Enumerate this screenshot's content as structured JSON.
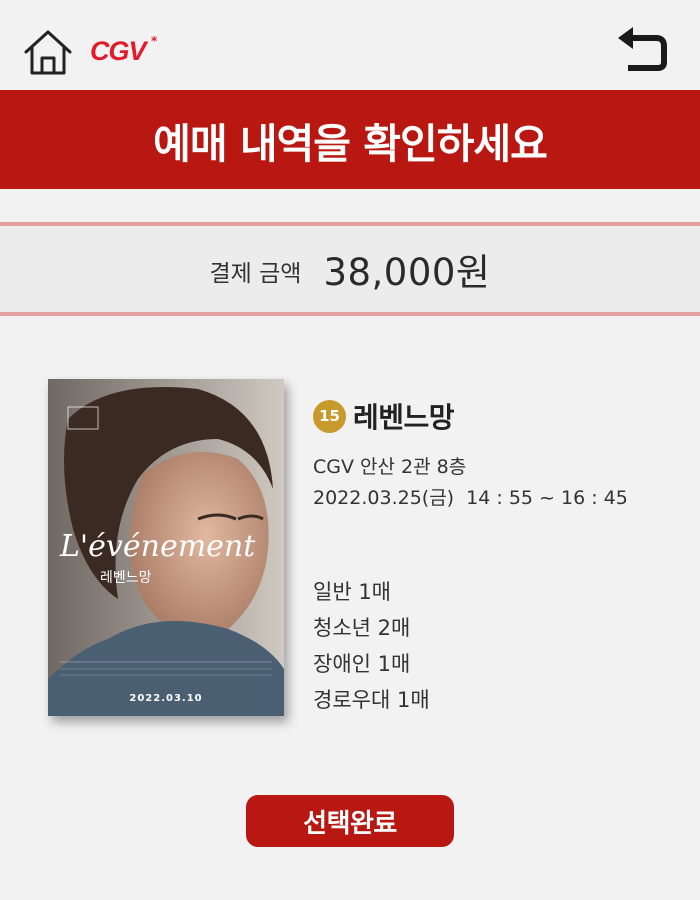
{
  "header": {
    "logo_text": "CGV",
    "logo_star": "*",
    "home_icon": "home-icon",
    "back_icon": "back-arrow-icon",
    "accent_color": "#b81811"
  },
  "banner": {
    "title": "예매 내역을 확인하세요"
  },
  "payment": {
    "label": "결제 금액",
    "amount": "38,000원"
  },
  "movie": {
    "rating": "15",
    "title": "레벤느망",
    "theater": "CGV 안산 2관 8층",
    "datetime": "2022.03.25(금)  14 : 55 ~ 16 : 45",
    "poster": {
      "title": "L'événement",
      "subtitle": "레벤느망",
      "date": "2022.03.10"
    }
  },
  "tickets": [
    {
      "text": "일반 1매"
    },
    {
      "text": "청소년 2매"
    },
    {
      "text": "장애인 1매"
    },
    {
      "text": "경로우대 1매"
    }
  ],
  "actions": {
    "confirm_label": "선택완료"
  }
}
